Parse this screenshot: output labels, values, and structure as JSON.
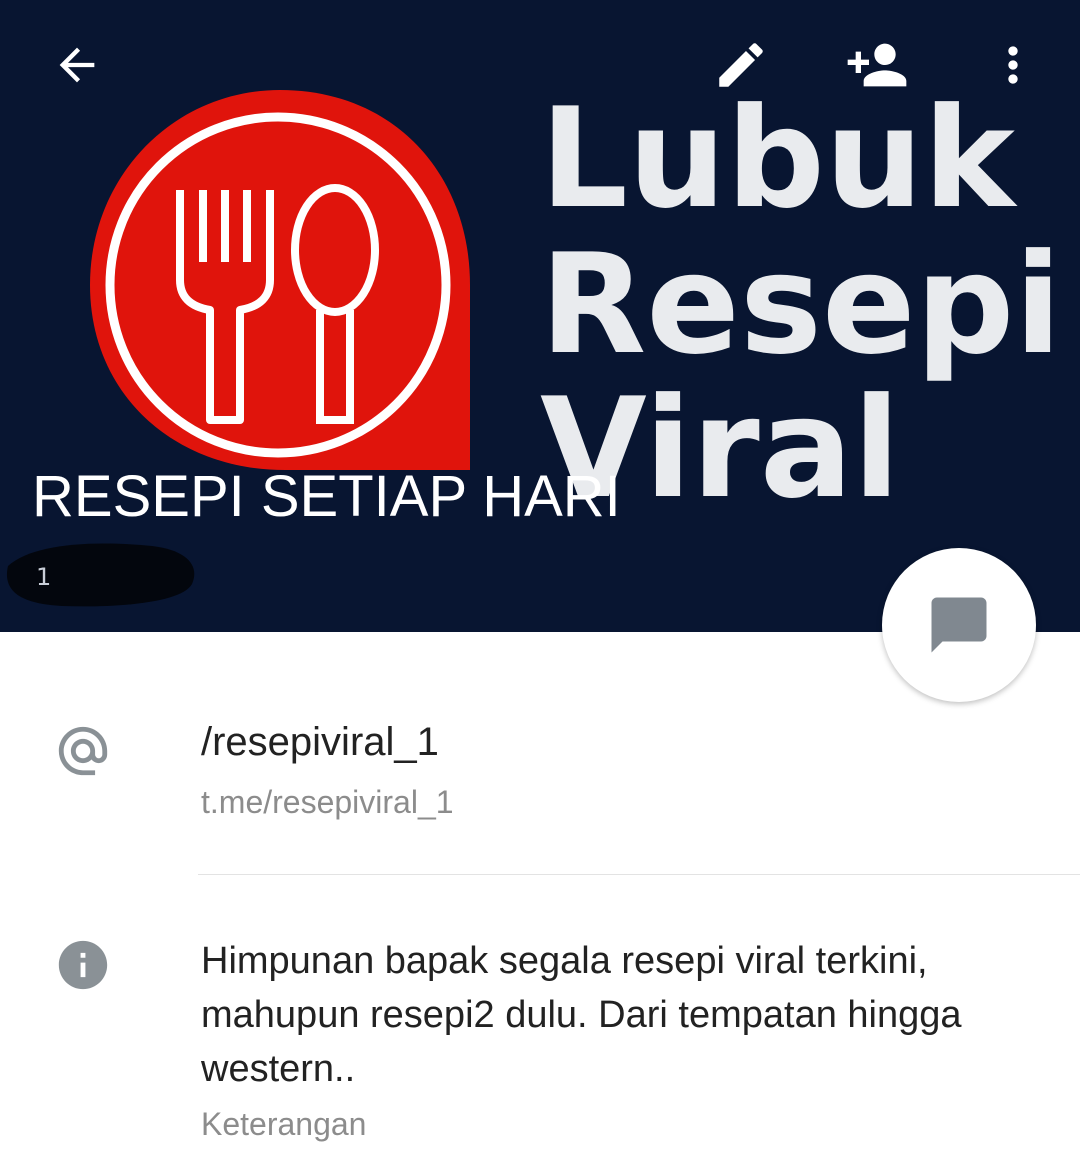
{
  "header": {
    "channel_name": "RESEPI SETIAP HARI",
    "subscriber_count": "1",
    "cover_logo": {
      "line1": "Lubuk",
      "line2": "Resepi",
      "line3": "Viral",
      "icon": "fork-spoon-icon"
    },
    "actions": [
      {
        "name": "back",
        "icon": "arrow-left-icon"
      },
      {
        "name": "edit",
        "icon": "pencil-icon"
      },
      {
        "name": "add-member",
        "icon": "person-add-icon"
      },
      {
        "name": "more",
        "icon": "more-vert-icon"
      }
    ]
  },
  "fab": {
    "icon": "message-icon"
  },
  "info": {
    "username": {
      "icon": "at-sign-icon",
      "value": "/resepiviral_1",
      "link": "t.me/resepiviral_1"
    },
    "description": {
      "icon": "info-icon",
      "lines": [
        "Himpunan bapak segala resepi viral terkini,",
        "mahupun resepi2 dulu. Dari tempatan hingga",
        "western.."
      ],
      "label": "Keterangan"
    }
  },
  "colors": {
    "header_bg": "#081531",
    "logo_red": "#e0140c",
    "icon_gray": "#8a9196",
    "text_primary": "#222222",
    "text_secondary": "#8c8c8c"
  }
}
